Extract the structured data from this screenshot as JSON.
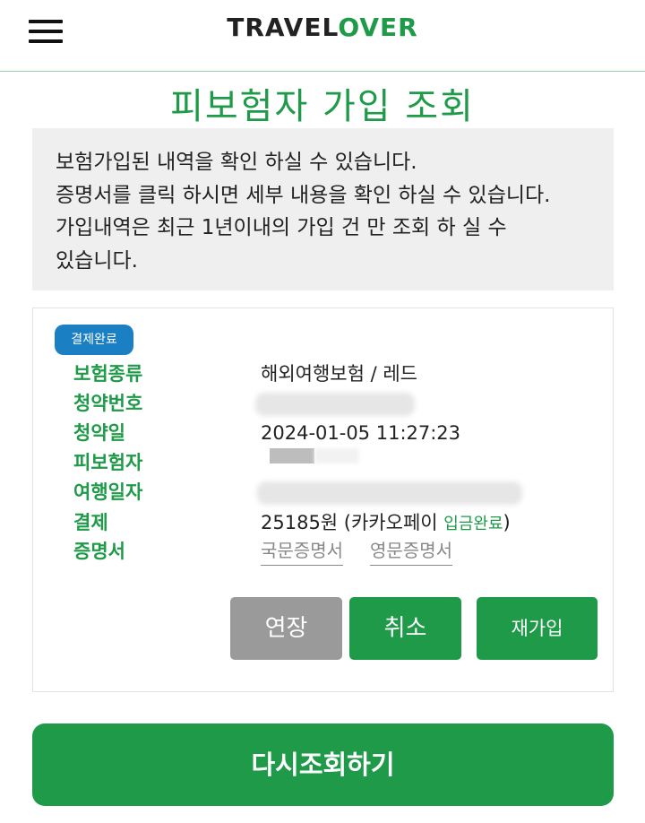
{
  "header": {
    "logo_part1": "TRAVEL",
    "logo_part2": "OVER",
    "menu_icon": "hamburger-menu-icon"
  },
  "page_title": "피보험자 가입 조회",
  "notice": {
    "line1": "보험가입된 내역을 확인 하실 수 있습니다.",
    "line2": "증명서를 클릭 하시면 세부 내용을 확인 하실 수 있습니다.",
    "line3": "가입내역은 최근 1년이내의 가입 건 만 조회 하 실 수",
    "line4": "있습니다."
  },
  "record": {
    "status_badge": "결제완료",
    "labels": {
      "insurance_type": "보험종류",
      "contract_no": "청약번호",
      "contract_date": "청약일",
      "insured": "피보험자",
      "travel_period": "여행일자",
      "payment": "결제",
      "certificate": "증명서"
    },
    "values": {
      "insurance_type": "해외여행보험 / 레드",
      "contract_date": "2024-01-05 11:27:23",
      "payment_amount": "25185원 (카카오페이 ",
      "payment_status": "입금완료",
      "payment_close": ")"
    },
    "certificates": {
      "korean": "국문증명서",
      "english": "영문증명서"
    },
    "buttons": {
      "extend": "연장",
      "cancel": "취소",
      "rejoin": "재가입"
    }
  },
  "retry_button": "다시조회하기",
  "colors": {
    "brand_green": "#1e9a48",
    "badge_blue": "#1b7fc4",
    "disabled_gray": "#9a9a9a",
    "notice_bg": "#efefef"
  }
}
